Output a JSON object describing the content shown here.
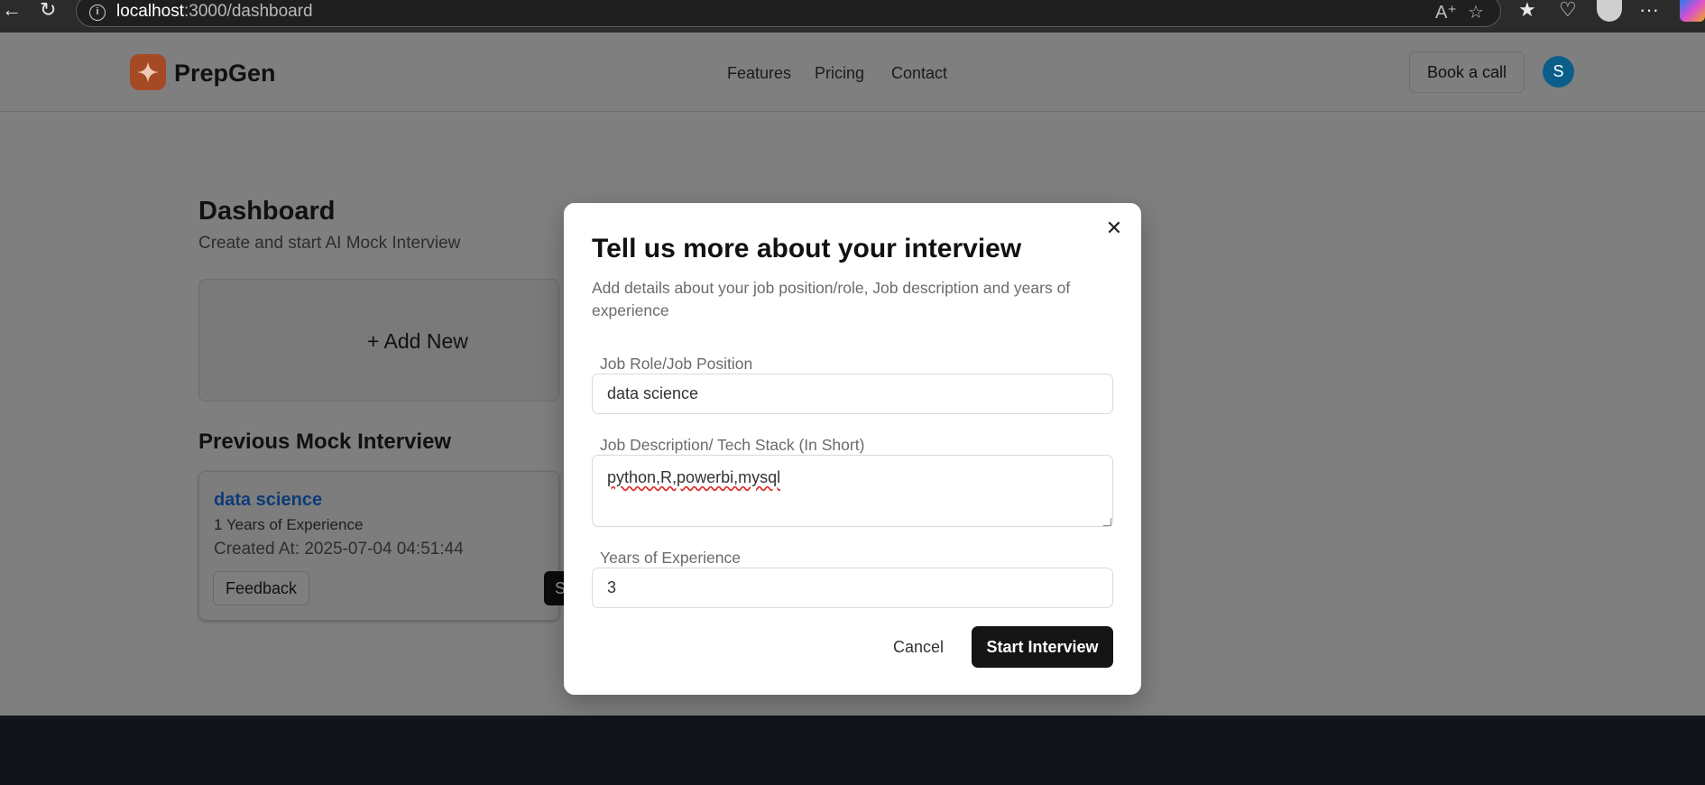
{
  "browser": {
    "url_host": "localhost",
    "url_path": ":3000/dashboard",
    "back_icon": "arrow-left-icon",
    "reload_icon": "reload-icon"
  },
  "header": {
    "brand": "PrepGen",
    "nav": [
      "Features",
      "Pricing",
      "Contact"
    ],
    "book_call": "Book a call",
    "avatar_initial": "S"
  },
  "dashboard": {
    "title": "Dashboard",
    "subtitle": "Create and start AI Mock Interview",
    "add_new": "+ Add New",
    "previous_title": "Previous Mock Interview",
    "interview": {
      "role": "data science",
      "experience": "1 Years of Experience",
      "created": "Created At: 2025-07-04 04:51:44",
      "feedback_label": "Feedback",
      "start_label_visible": "S"
    }
  },
  "modal": {
    "title": "Tell us more about your interview",
    "description": "Add details about your job position/role, Job description and years of experience",
    "fields": {
      "role_label": "Job Role/Job Position",
      "role_value": "data science",
      "desc_label": "Job Description/ Tech Stack (In Short)",
      "desc_value": "python,R,powerbi,mysql",
      "years_label": "Years of Experience",
      "years_value": "3"
    },
    "cancel": "Cancel",
    "submit": "Start Interview"
  },
  "colors": {
    "overlay_dim": "#7f7f7f",
    "brand_orange": "#a54a25",
    "link_blue": "#0e3a78",
    "avatar_blue": "#0b5e8a",
    "primary_button": "#151515",
    "footer": "#111418"
  }
}
